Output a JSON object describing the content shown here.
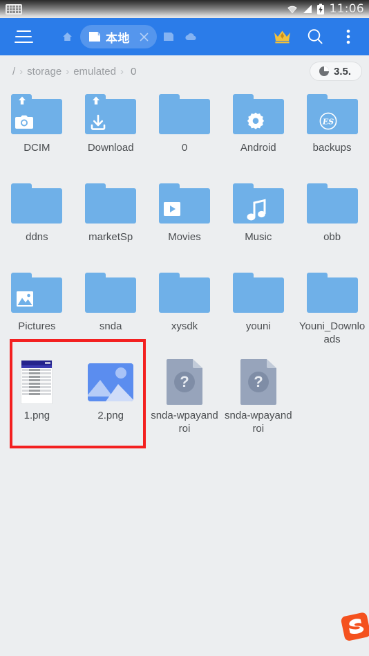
{
  "status_bar": {
    "keyboard_icon": "keyboard-icon",
    "wifi_icon": "wifi-icon",
    "signal_icon": "signal-icon",
    "battery_icon": "battery-charging-icon",
    "clock": "11:06"
  },
  "toolbar": {
    "menu_icon": "hamburger-menu-icon",
    "home_icon": "home-icon",
    "tab": {
      "icon": "sdcard-icon",
      "label": "本地",
      "close_icon": "close-icon"
    },
    "ghost_tabs": [
      {
        "icon": "sdcard-icon-inactive"
      },
      {
        "icon": "cloud-icon-inactive"
      }
    ],
    "actions": [
      {
        "icon": "crown-icon",
        "name": "premium-button"
      },
      {
        "icon": "search-icon",
        "name": "search-button"
      },
      {
        "icon": "overflow-menu-icon",
        "name": "overflow-menu-button"
      }
    ],
    "accent_color": "#2b7ce9"
  },
  "breadcrumb": {
    "items": [
      "/",
      "storage",
      "emulated",
      "0"
    ],
    "separator": "›"
  },
  "storage_badge": {
    "icon": "pie-chart-icon",
    "value": "3.5."
  },
  "grid": {
    "folder_color": "#6fb0e8",
    "items": [
      {
        "name": "DCIM",
        "type": "folder",
        "badge": "camera-icon",
        "overlay": "upload-arrow-icon"
      },
      {
        "name": "Download",
        "type": "folder",
        "badge": "download-icon",
        "overlay": "upload-arrow-icon"
      },
      {
        "name": "0",
        "type": "folder",
        "badge": "none",
        "overlay": "none"
      },
      {
        "name": "Android",
        "type": "folder",
        "badge": "gear-icon",
        "overlay": "none"
      },
      {
        "name": "backups",
        "type": "folder",
        "badge": "es-logo-icon",
        "overlay": "none"
      },
      {
        "name": "ddns",
        "type": "folder",
        "badge": "none",
        "overlay": "none"
      },
      {
        "name": "marketSp",
        "type": "folder",
        "badge": "none",
        "overlay": "none"
      },
      {
        "name": "Movies",
        "type": "folder",
        "badge": "play-icon",
        "overlay": "none"
      },
      {
        "name": "Music",
        "type": "folder",
        "badge": "music-note-icon",
        "overlay": "none"
      },
      {
        "name": "obb",
        "type": "folder",
        "badge": "none",
        "overlay": "none"
      },
      {
        "name": "Pictures",
        "type": "folder",
        "badge": "picture-icon",
        "overlay": "none"
      },
      {
        "name": "snda",
        "type": "folder",
        "badge": "none",
        "overlay": "none"
      },
      {
        "name": "xysdk",
        "type": "folder",
        "badge": "none",
        "overlay": "none"
      },
      {
        "name": "youni",
        "type": "folder",
        "badge": "none",
        "overlay": "none"
      },
      {
        "name": "Youni_Downloads",
        "type": "folder",
        "badge": "none",
        "overlay": "none"
      },
      {
        "name": "1.png",
        "type": "image-screenshot-thumb",
        "badge": "none",
        "overlay": "none"
      },
      {
        "name": "2.png",
        "type": "image-placeholder",
        "badge": "none",
        "overlay": "none"
      },
      {
        "name": "snda-wpayandroi",
        "type": "unknown-file",
        "badge": "question-mark-icon",
        "overlay": "none"
      },
      {
        "name": "snda-wpayandroi",
        "type": "unknown-file",
        "badge": "question-mark-icon",
        "overlay": "none"
      }
    ]
  },
  "annotation": {
    "selection_box_color": "#f32020"
  },
  "ime_logo": {
    "icon": "sogou-logo-icon"
  }
}
